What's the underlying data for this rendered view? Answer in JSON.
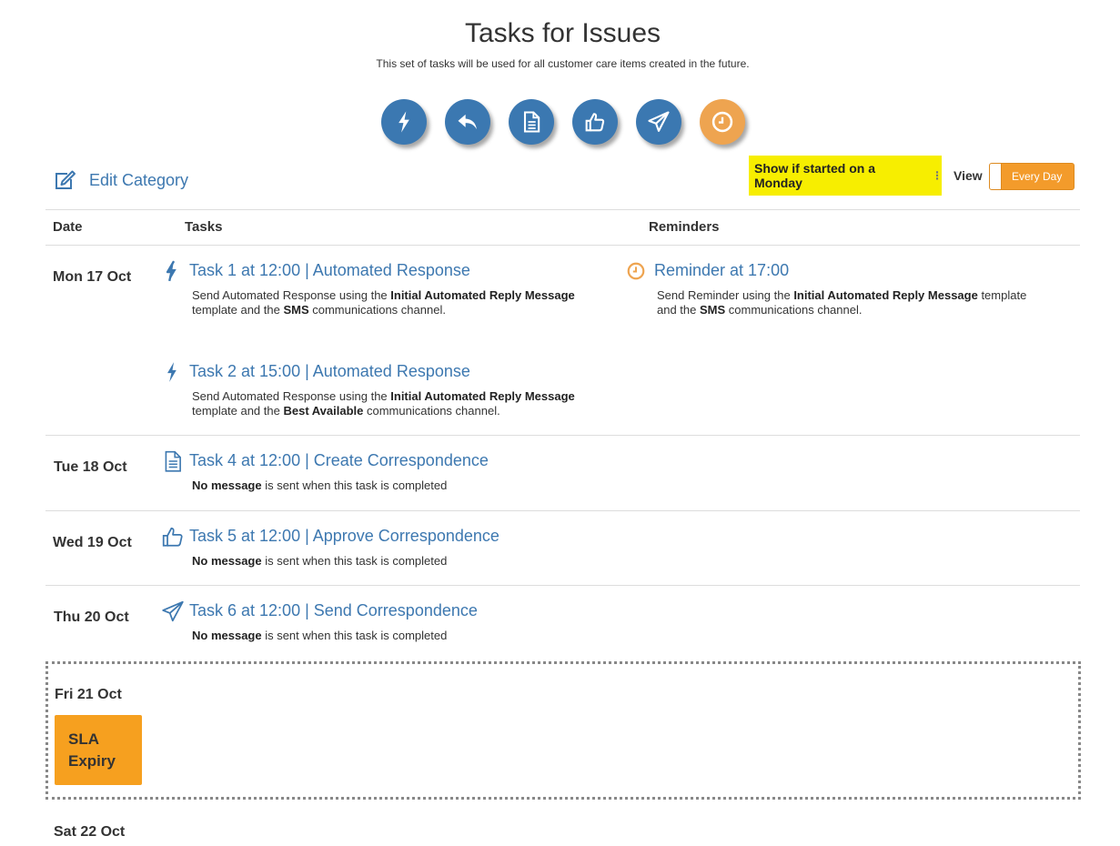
{
  "header": {
    "title": "Tasks for Issues",
    "subtitle": "This set of tasks will be used for all customer care items created in the future."
  },
  "toolbar": {
    "buttons": [
      {
        "icon": "lightning-icon",
        "color": "#3b78b1"
      },
      {
        "icon": "reply-icon",
        "color": "#3b78b1"
      },
      {
        "icon": "document-icon",
        "color": "#3b78b1"
      },
      {
        "icon": "thumbs-up-icon",
        "color": "#3b78b1"
      },
      {
        "icon": "send-icon",
        "color": "#3b78b1"
      },
      {
        "icon": "clock-icon",
        "color": "#eea450"
      }
    ]
  },
  "edit_category": {
    "label": "Edit Category"
  },
  "filter": {
    "label": "Show if started on a Monday",
    "highlight_color": "#f7ee00"
  },
  "view": {
    "label": "View",
    "toggle_label": "Every Day",
    "toggle_color": "#f39b2b"
  },
  "table": {
    "headers": {
      "date": "Date",
      "tasks": "Tasks",
      "reminders": "Reminders"
    }
  },
  "days": {
    "mon": {
      "date": "Mon 17 Oct",
      "task1": {
        "title": "Task 1 at 12:00 | Automated Response",
        "d1": "Send Automated Response using the ",
        "b1": "Initial Automated Reply Message",
        "d2": "template and the ",
        "b2": "SMS",
        "d3": " communications channel."
      },
      "reminder1": {
        "title": "Reminder at 17:00",
        "d1": "Send Reminder using the ",
        "b1": "Initial Automated Reply Message",
        "d1b": " template",
        "d2": "and the ",
        "b2": "SMS",
        "d3": " communications channel."
      },
      "task2": {
        "title": "Task 2 at 15:00 | Automated Response",
        "d1": "Send Automated Response using the ",
        "b1": "Initial Automated Reply Message",
        "d2": "template and the ",
        "b2": "Best Available",
        "d3": " communications channel."
      }
    },
    "tue": {
      "date": "Tue 18 Oct",
      "task": {
        "title": "Task 4 at 12:00 | Create Correspondence",
        "b1": "No message",
        "d1": " is sent when this task is completed"
      }
    },
    "wed": {
      "date": "Wed 19 Oct",
      "task": {
        "title": "Task 5 at 12:00 | Approve Correspondence",
        "b1": "No message",
        "d1": " is sent when this task is completed"
      }
    },
    "thu": {
      "date": "Thu 20 Oct",
      "task": {
        "title": "Task 6 at 12:00 | Send Correspondence",
        "b1": "No message",
        "d1": " is sent when this task is completed"
      }
    },
    "fri": {
      "date": "Fri 21 Oct",
      "sla_line1": "SLA",
      "sla_line2": "Expiry",
      "sla_color": "#f6a01f"
    },
    "sat": {
      "date": "Sat 22 Oct"
    }
  },
  "colors": {
    "accent": "#3d78b0",
    "reminder": "#eea450"
  }
}
